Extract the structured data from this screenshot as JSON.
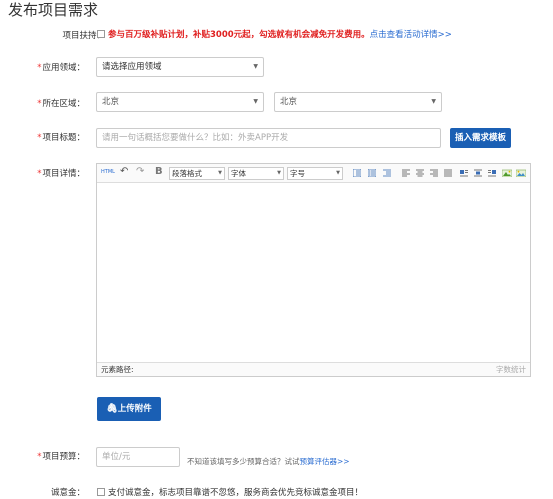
{
  "page": {
    "title": "发布项目需求"
  },
  "support": {
    "label": "项目扶持：",
    "text": "参与百万级补贴计划，补贴3000元起，勾选就有机会减免开发费用。",
    "link": "点击查看活动详情>>"
  },
  "field_domain": {
    "label": "应用领域：",
    "value": "请选择应用领域"
  },
  "field_region": {
    "label": "所在区域：",
    "province": "北京",
    "city": "北京"
  },
  "field_title": {
    "label": "项目标题：",
    "placeholder": "请用一句话概括您要做什么？比如：外卖APP开发",
    "insert_button": "插入需求模板"
  },
  "field_detail": {
    "label": "项目详情：",
    "toolbar": {
      "html_label": "HTML",
      "bold_label": "B",
      "paragraph": "段落格式",
      "font": "字体",
      "size": "字号"
    },
    "footer_left": "元素路径:",
    "footer_right": "字数统计"
  },
  "upload": {
    "label": "上传附件"
  },
  "budget": {
    "label": "项目预算：",
    "placeholder": "单位/元",
    "hint": "不知道该填写多少预算合适？试试",
    "hint_link": "预算评估器>>"
  },
  "deposit": {
    "label": "诚意金：",
    "text": "支付诚意金，标志项目靠谱不忽悠，服务商会优先竞标诚意金项目！"
  },
  "colors": {
    "accent": "#1a5fb4",
    "required": "#e02020",
    "link": "#2a6cd1"
  }
}
